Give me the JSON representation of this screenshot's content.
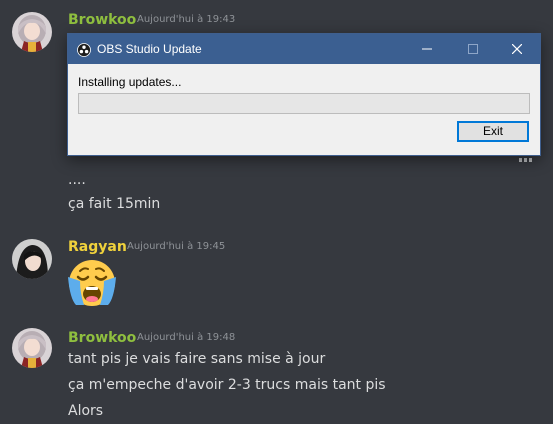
{
  "colors": {
    "background": "#36393f",
    "browkoo_name": "#8fbf3f",
    "ragyan_name": "#f0d23c",
    "timestamp": "#8e9297",
    "message_text": "#dcddde",
    "dialog_titlebar": "#3b5f91",
    "dialog_body": "#f0f0f0",
    "progress_fill": "#06b025"
  },
  "messages": [
    {
      "author": "Browkoo",
      "timestamp": "Aujourd'hui à 19:43",
      "lines": [
        "....",
        "ça fait 15min"
      ]
    },
    {
      "author": "Ragyan",
      "timestamp": "Aujourd'hui à 19:45",
      "emoji": "loudly-crying-face"
    },
    {
      "author": "Browkoo",
      "timestamp": "Aujourd'hui à 19:48",
      "lines": [
        "tant pis je vais faire sans mise à jour",
        "ça m'empeche d'avoir 2-3 trucs mais tant pis",
        "Alors"
      ]
    }
  ],
  "dialog": {
    "title": "OBS Studio Update",
    "status": "Installing updates...",
    "progress": 0,
    "exit_label": "Exit",
    "icons": [
      "obs-icon",
      "minimize-icon",
      "maximize-icon",
      "close-icon"
    ]
  }
}
